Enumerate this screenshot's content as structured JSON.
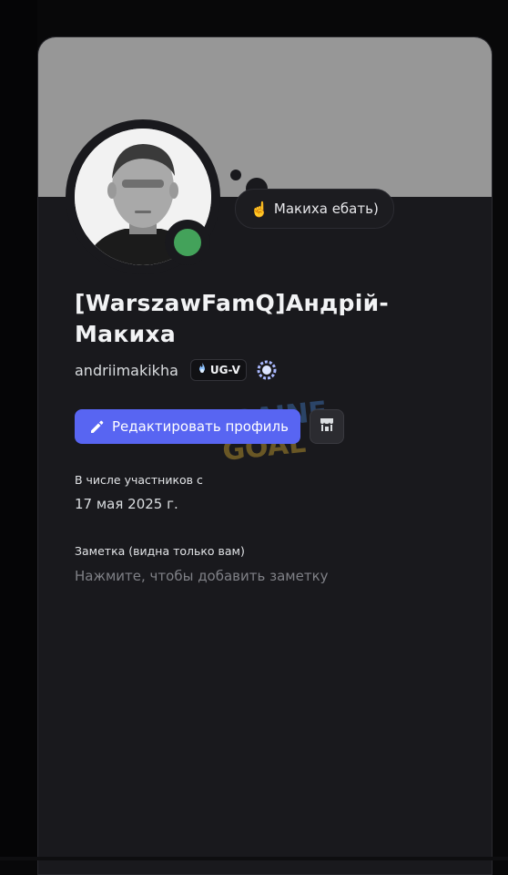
{
  "profile": {
    "display_name": "[WarszawFamQ]Андрій-Макиха",
    "username": "andriimakikha",
    "status": "online",
    "custom_status": {
      "emoji": "☝️",
      "text": "Макиха ебать)"
    },
    "server_tag": {
      "icon": "flame-icon",
      "label": "UG-V"
    },
    "nitro_badge": "laurel-badge-icon"
  },
  "actions": {
    "edit_profile_label": "Редактировать профиль",
    "shop_icon": "shop-icon"
  },
  "member_since": {
    "label": "В числе участников с",
    "value": "17 мая 2025 г."
  },
  "note": {
    "label": "Заметка (видна только вам)",
    "placeholder": "Нажмите, чтобы добавить заметку"
  },
  "colors": {
    "accent": "#5865f2",
    "online": "#43a25a",
    "banner": "#979797",
    "card_bg": "#19191d"
  }
}
